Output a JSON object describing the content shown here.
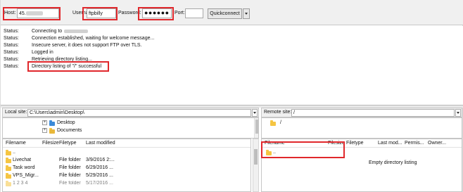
{
  "quickconnect": {
    "host_label": "Host:",
    "host_value": "45.",
    "username_label": "Username:",
    "username_value": "ftpbilly",
    "password_label": "Password:",
    "password_value": "●●●●●●",
    "port_label": "Port:",
    "port_value": "",
    "connect_button": "Quickconnect"
  },
  "log": {
    "status_label": "Status:",
    "messages": [
      "Connecting to",
      "Connection established, waiting for welcome message...",
      "Insecure server, it does not support FTP over TLS.",
      "Logged in",
      "Retrieving directory listing...",
      "Directory listing of \"/\" successful"
    ]
  },
  "local": {
    "site_label": "Local site:",
    "path": "C:\\Users\\admin\\Desktop\\",
    "tree": [
      "Desktop",
      "Documents"
    ],
    "columns": [
      "Filename",
      "Filesize",
      "Filetype",
      "Last modified"
    ],
    "files": [
      {
        "name": "..",
        "type": "",
        "modified": ""
      },
      {
        "name": "Livechat",
        "type": "File folder",
        "modified": "3/9/2016 2:..."
      },
      {
        "name": "Task word",
        "type": "File folder",
        "modified": "6/29/2016 ..."
      },
      {
        "name": "VPS_Migr...",
        "type": "File folder",
        "modified": "5/29/2016 ..."
      },
      {
        "name": "1 2 3 4",
        "type": "File folder",
        "modified": "5/17/2016 ..."
      }
    ]
  },
  "remote": {
    "site_label": "Remote site:",
    "path": "/",
    "tree": [
      "/"
    ],
    "columns": [
      "Filename",
      "Filesize",
      "Filetype",
      "Last mod...",
      "Permis...",
      "Owner..."
    ],
    "files": [
      {
        "name": ".."
      }
    ],
    "empty_text": "Empty directory listing"
  },
  "colors": {
    "highlight": "#e0282c",
    "folder": "#f5c542",
    "desktop_folder": "#3c8ad8"
  }
}
